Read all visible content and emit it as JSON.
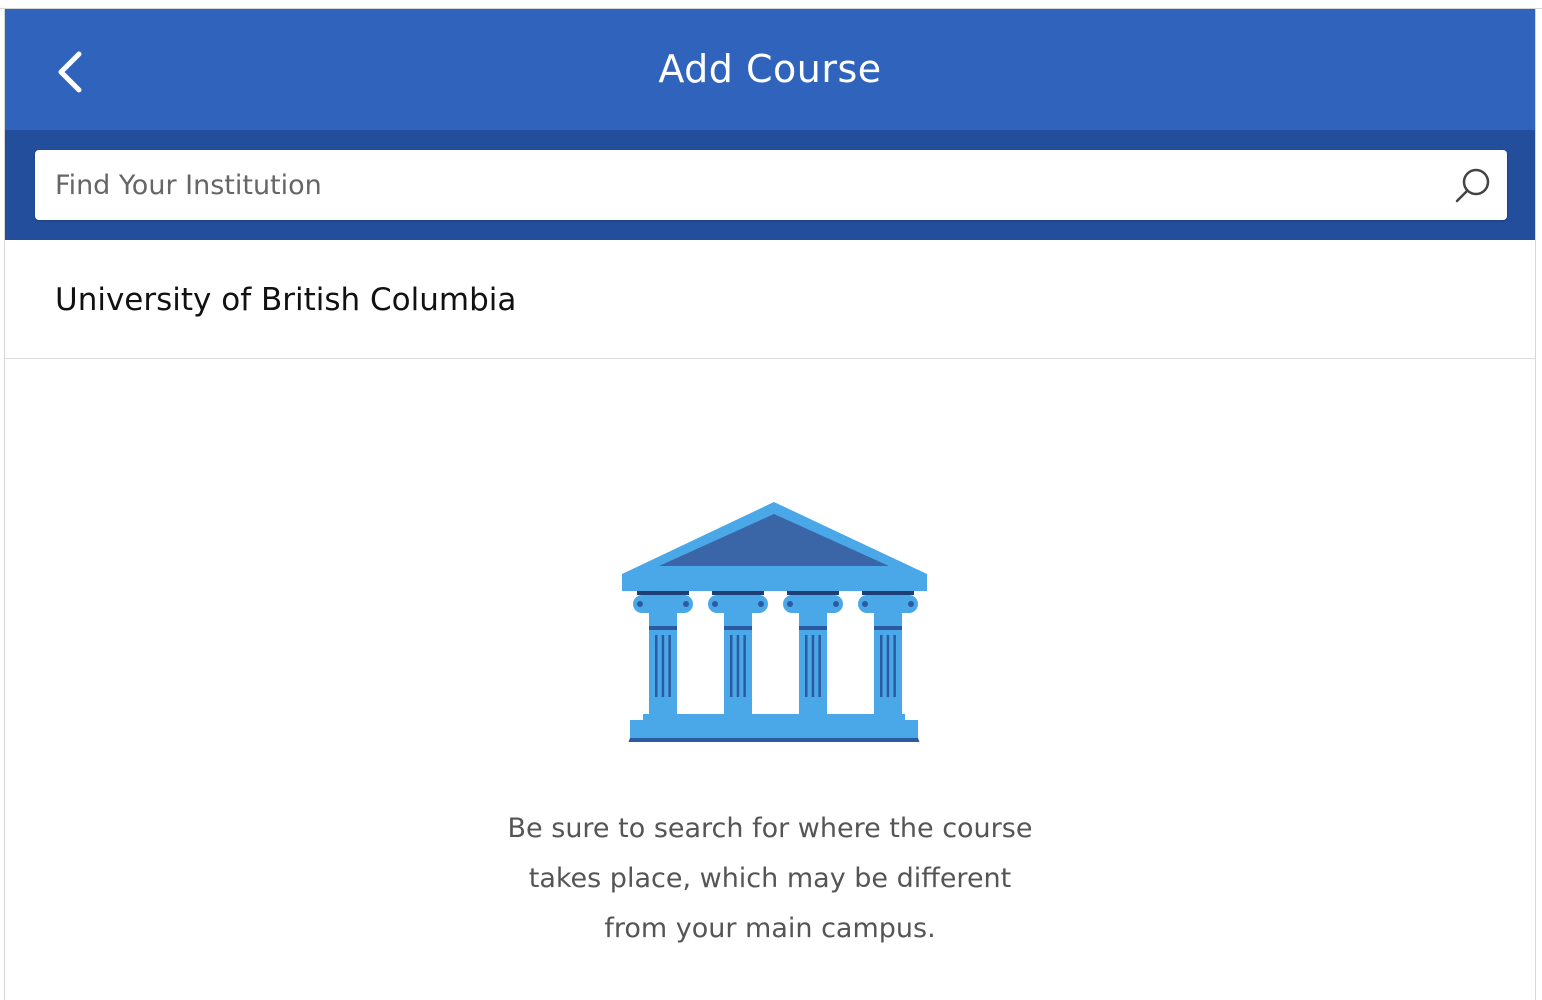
{
  "header": {
    "title": "Add Course",
    "back_icon": "chevron-left-icon",
    "background": "#3064bc"
  },
  "search": {
    "placeholder": "Find Your Institution",
    "value": "",
    "icon": "search-icon",
    "band_color": "#234e9c"
  },
  "results": [
    {
      "label": "University of British Columbia"
    }
  ],
  "empty_state": {
    "icon": "institution-building-icon",
    "lines": [
      "Be sure to search for where the course",
      "takes place, which may be different",
      "from your main campus."
    ],
    "colors": {
      "light": "#4aa8e8",
      "dark": "#3a66a8",
      "shadow": "#2c5aa0"
    }
  }
}
